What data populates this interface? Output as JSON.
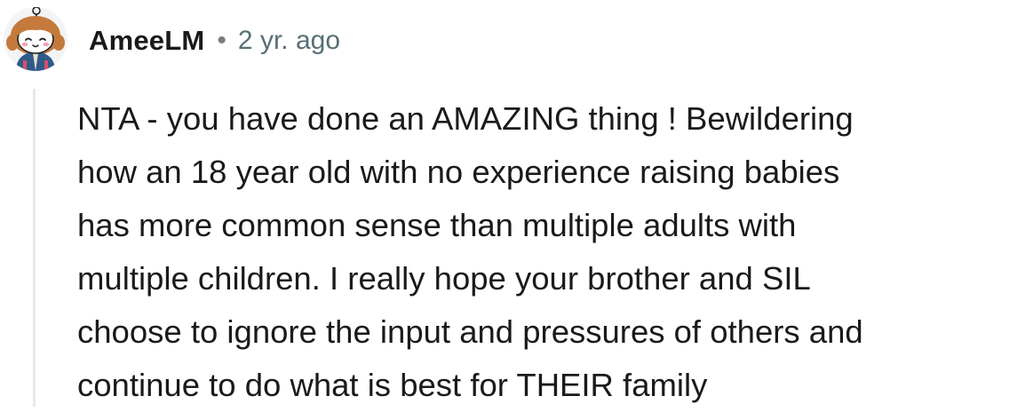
{
  "comment": {
    "author": "AmeeLM",
    "separator": "•",
    "timestamp": "2 yr. ago",
    "avatar_icon": "snoo-avatar-icon",
    "body_lines": [
      "NTA - you have done an AMAZING thing ! Bewildering",
      "how an 18 year old with no experience raising babies",
      "has more common sense than multiple adults with",
      "multiple children. I really hope your brother and SIL",
      "choose to ignore the input and pressures of others and",
      "continue to do what is best for THEIR family"
    ]
  },
  "colors": {
    "author": "#1a1a1b",
    "timestamp": "#576f76",
    "thread_line": "#e5e9eb",
    "avatar_hair": "#c47a3c",
    "avatar_jacket": "#2e5b8a"
  }
}
